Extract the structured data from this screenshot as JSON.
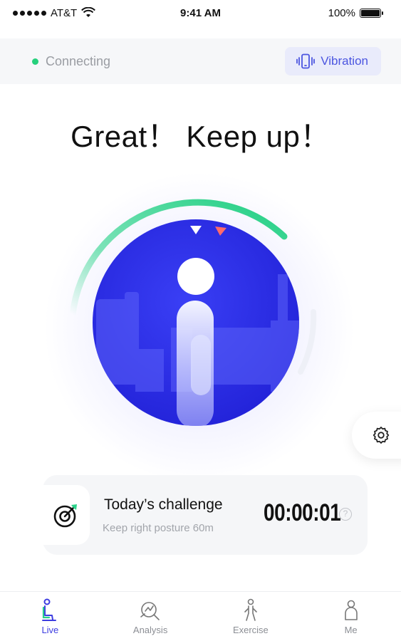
{
  "status_bar": {
    "carrier": "AT&T",
    "time": "9:41 AM",
    "battery": "100%"
  },
  "connection": {
    "status": "Connecting",
    "vibration_label": "Vibration"
  },
  "headline": "Great！ Keep up！",
  "gauge": {
    "level": 0.62,
    "colors": {
      "arc": "#2bd38a",
      "circle": "#2a2ee8",
      "marker_current": "#ffffff",
      "marker_target": "#ff6b6b"
    }
  },
  "challenge": {
    "title": "Today’s challenge",
    "subtitle": "Keep right posture 60m",
    "timer": "00:00:01",
    "help": "?"
  },
  "tabs": [
    {
      "label": "Live",
      "icon": "live-icon",
      "active": true
    },
    {
      "label": "Analysis",
      "icon": "analysis-icon",
      "active": false
    },
    {
      "label": "Exercise",
      "icon": "exercise-icon",
      "active": false
    },
    {
      "label": "Me",
      "icon": "me-icon",
      "active": false
    }
  ]
}
